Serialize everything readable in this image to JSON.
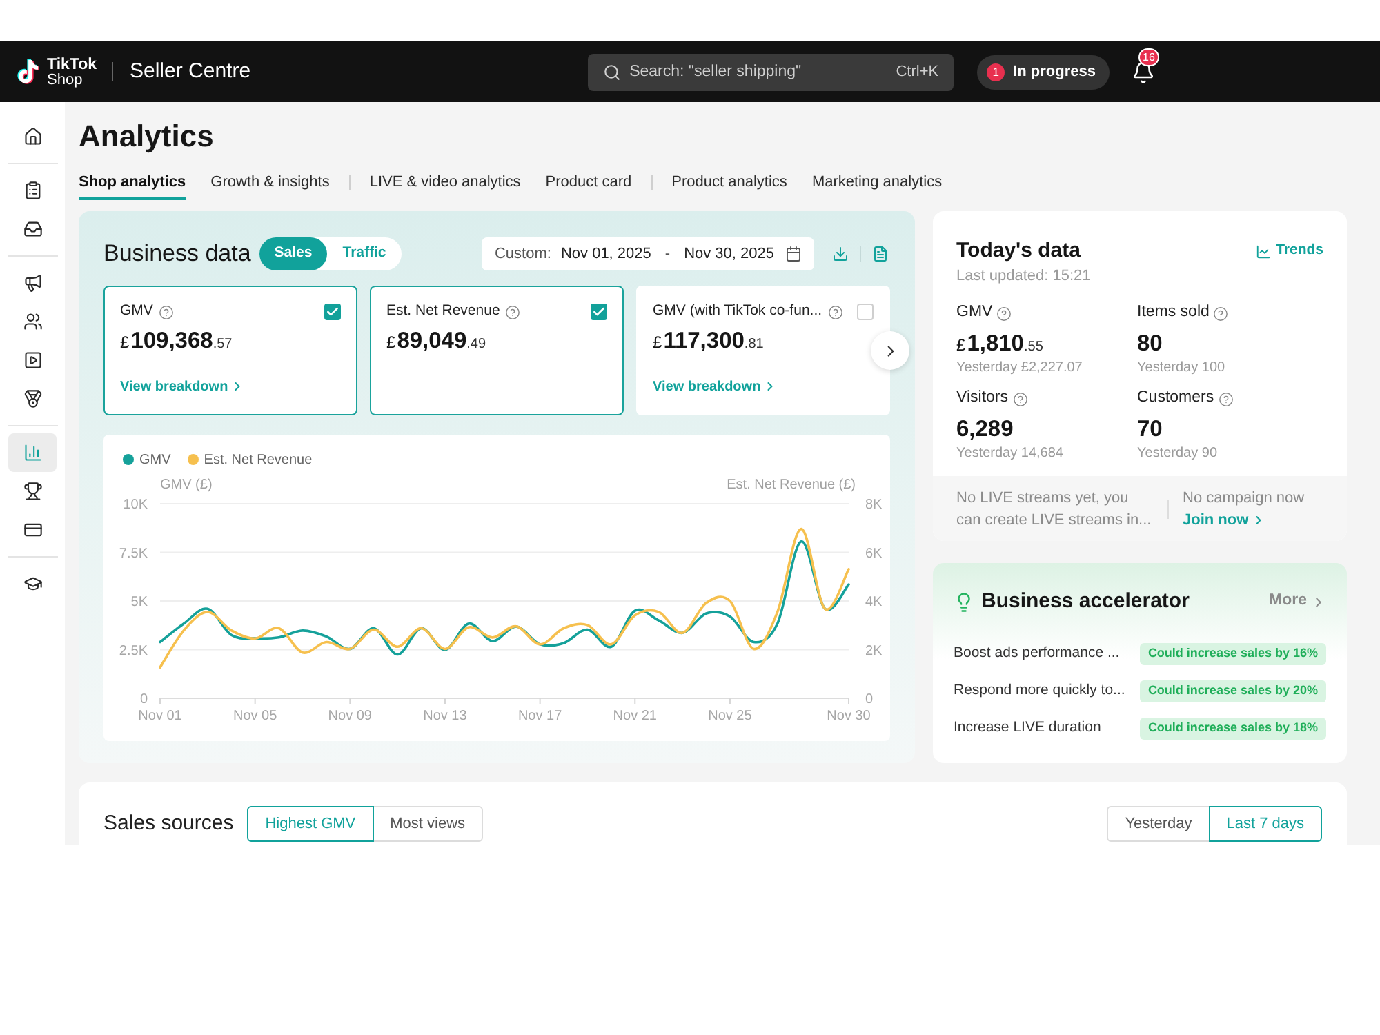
{
  "top_bar": {
    "logo": {
      "wordmark": "TikTok",
      "subtitle": "Shop"
    },
    "app_title": "Seller Centre",
    "search": {
      "placeholder": "Search: \"seller shipping\"",
      "shortcut": "Ctrl+K"
    },
    "progress": {
      "count": "1",
      "label": "In progress"
    },
    "notifications": {
      "count": "16"
    }
  },
  "sidebar": {
    "groups": [
      {
        "items": [
          {
            "selected": false
          }
        ]
      },
      {
        "items": [
          {
            "selected": false
          },
          {
            "selected": false
          }
        ]
      },
      {
        "items": [
          {
            "selected": false
          },
          {
            "selected": false
          },
          {
            "selected": false
          },
          {
            "selected": false
          }
        ]
      },
      {
        "items": [
          {
            "selected": true
          },
          {
            "selected": false
          },
          {
            "selected": false
          }
        ]
      },
      {
        "items": [
          {
            "selected": false
          }
        ]
      }
    ]
  },
  "page": {
    "title": "Analytics",
    "tab_groups": [
      {
        "tabs": [
          {
            "label": "Shop analytics",
            "selected": true
          },
          {
            "label": "Growth & insights",
            "selected": false
          }
        ]
      },
      {
        "tabs": [
          {
            "label": "LIVE & video analytics",
            "selected": false
          },
          {
            "label": "Product card",
            "selected": false
          }
        ]
      },
      {
        "tabs": [
          {
            "label": "Product analytics",
            "selected": false
          },
          {
            "label": "Marketing analytics",
            "selected": false
          }
        ]
      }
    ]
  },
  "business_data": {
    "title": "Business data",
    "modes": [
      {
        "label": "Sales",
        "selected": true
      },
      {
        "label": "Traffic",
        "selected": false
      }
    ],
    "date_range": {
      "prefix": "Custom:",
      "start": "Nov 01, 2025",
      "separator": "-",
      "end": "Nov 30, 2025"
    },
    "metric_cards": [
      {
        "title": "GMV",
        "checked": true,
        "currency": "£",
        "whole": "109,368",
        "fraction": ".57",
        "link": "View breakdown"
      },
      {
        "title": "Est. Net Revenue",
        "checked": true,
        "currency": "£",
        "whole": "89,049",
        "fraction": ".49"
      },
      {
        "title": "GMV (with TikTok co-fun...",
        "checked": false,
        "currency": "£",
        "whole": "117,300",
        "fraction": ".81",
        "link": "View breakdown"
      }
    ],
    "chart_data": {
      "type": "line",
      "ylabel": "GMV (£)",
      "y2label": "Est. Net Revenue (£)",
      "legend": "top",
      "grid": true,
      "categories": [
        "Nov 01",
        null,
        null,
        null,
        "Nov 05",
        null,
        null,
        null,
        "Nov 09",
        null,
        null,
        null,
        "Nov 13",
        null,
        null,
        null,
        "Nov 17",
        null,
        null,
        null,
        "Nov 21",
        null,
        null,
        null,
        "Nov 25",
        null,
        null,
        null,
        null,
        "Nov 30"
      ],
      "ylim": [
        0,
        10000
      ],
      "yticks": [
        {
          "value": 0,
          "label": "0"
        },
        {
          "value": 2500,
          "label": "2.5K"
        },
        {
          "value": 5000,
          "label": "5K"
        },
        {
          "value": 7500,
          "label": "7.5K"
        },
        {
          "value": 10000,
          "label": "10K"
        }
      ],
      "y2lim": [
        0,
        8000
      ],
      "y2ticks": [
        {
          "value": 0,
          "label": "0"
        },
        {
          "value": 2000,
          "label": "2K"
        },
        {
          "value": 4000,
          "label": "4K"
        },
        {
          "value": 6000,
          "label": "6K"
        },
        {
          "value": 8000,
          "label": "8K"
        }
      ],
      "series": [
        {
          "name": "GMV",
          "color": "#15a19a",
          "values": [
            2890,
            3840,
            4600,
            3250,
            3080,
            3130,
            3480,
            3180,
            2540,
            3600,
            2250,
            3600,
            2490,
            3840,
            2940,
            3690,
            2770,
            2840,
            3530,
            2650,
            4500,
            4000,
            3360,
            4360,
            4200,
            2890,
            3840,
            8060,
            4600,
            5850
          ]
        },
        {
          "name": "Est. Net Revenue",
          "color": "#f6c04e",
          "axis": "y2",
          "values": [
            1270,
            2790,
            3550,
            2790,
            2460,
            2880,
            1880,
            2310,
            2030,
            2820,
            2120,
            2880,
            2030,
            2920,
            2500,
            2960,
            2220,
            2880,
            3010,
            2220,
            3410,
            3550,
            2690,
            3920,
            4000,
            2030,
            3550,
            6960,
            3680,
            5310
          ]
        }
      ]
    }
  },
  "todays_data": {
    "title": "Today's data",
    "trends_link": "Trends",
    "last_updated": "Last updated: 15:21",
    "metrics": [
      {
        "label": "GMV",
        "currency": "£",
        "whole": "1,810",
        "fraction": ".55",
        "yesterday": "Yesterday £2,227.07"
      },
      {
        "label": "Items sold",
        "whole": "80",
        "yesterday": "Yesterday 100"
      },
      {
        "label": "Visitors",
        "whole": "6,289",
        "yesterday": "Yesterday 14,684"
      },
      {
        "label": "Customers",
        "whole": "70",
        "yesterday": "Yesterday 90"
      }
    ],
    "notices": [
      {
        "text": "No LIVE streams yet, you can create LIVE streams in..."
      },
      {
        "text": "No campaign now",
        "link": "Join now"
      }
    ]
  },
  "business_accelerator": {
    "title": "Business accelerator",
    "more_link": "More",
    "suggestions": [
      {
        "text": "Boost ads performance ...",
        "impact": "Could increase sales by 16%"
      },
      {
        "text": "Respond more quickly to...",
        "impact": "Could increase sales by 20%"
      },
      {
        "text": "Increase LIVE duration",
        "impact": "Could increase sales by 18%"
      }
    ]
  },
  "sales_sources": {
    "title": "Sales sources",
    "sort_options": [
      {
        "label": "Highest GMV",
        "selected": true
      },
      {
        "label": "Most views",
        "selected": false
      }
    ],
    "period_options": [
      {
        "label": "Yesterday",
        "selected": false
      },
      {
        "label": "Last 7 days",
        "selected": true
      }
    ]
  }
}
